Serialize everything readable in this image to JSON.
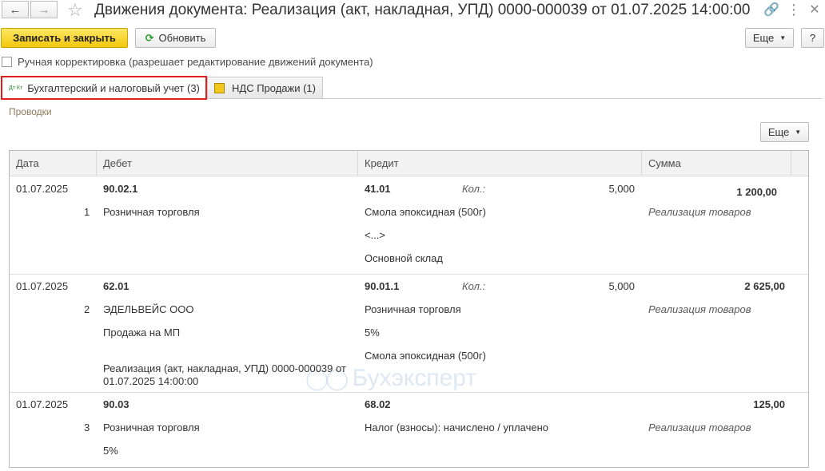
{
  "window": {
    "title": "Движения документа: Реализация (акт, накладная, УПД) 0000-000039 от 01.07.2025 14:00:00"
  },
  "toolbar": {
    "save_close": "Записать и закрыть",
    "refresh": "Обновить",
    "more": "Еще",
    "help": "?"
  },
  "manual_edit": {
    "label": "Ручная корректировка (разрешает редактирование движений документа)",
    "checked": false
  },
  "tabs": [
    {
      "icon_text": "Дт Кт",
      "label": "Бухгалтерский и налоговый учет (3)",
      "active": true
    },
    {
      "label": "НДС Продажи (1)",
      "active": false
    }
  ],
  "section": {
    "title": "Проводки",
    "more": "Еще"
  },
  "table": {
    "columns": [
      "Дата",
      "Дебет",
      "Кредит",
      "Сумма"
    ],
    "qty_label": "Кол.:",
    "rows": [
      {
        "date": "01.07.2025",
        "num": "1",
        "debit_account": "90.02.1",
        "debit_lines": [
          "Розничная торговля"
        ],
        "credit_account": "41.01",
        "credit_qty": "5,000",
        "credit_lines": [
          "Смола эпоксидная (500г)",
          "<...>",
          "Основной склад"
        ],
        "amount": "1 200,00",
        "comment": "Реализация товаров"
      },
      {
        "date": "01.07.2025",
        "num": "2",
        "debit_account": "62.01",
        "debit_lines": [
          "ЭДЕЛЬВЕЙС ООО",
          "Продажа на МП",
          "Реализация (акт, накладная, УПД) 0000-000039 от",
          "01.07.2025 14:00:00"
        ],
        "credit_account": "90.01.1",
        "credit_qty": "5,000",
        "credit_lines": [
          "Розничная торговля",
          "5%",
          "Смола эпоксидная (500г)"
        ],
        "amount": "2 625,00",
        "comment": "Реализация товаров"
      },
      {
        "date": "01.07.2025",
        "num": "3",
        "debit_account": "90.03",
        "debit_lines": [
          "Розничная торговля",
          "5%"
        ],
        "credit_account": "68.02",
        "credit_lines": [
          "Налог (взносы): начислено / уплачено"
        ],
        "amount": "125,00",
        "comment": "Реализация товаров"
      }
    ]
  },
  "watermark": "Бухэксперт"
}
